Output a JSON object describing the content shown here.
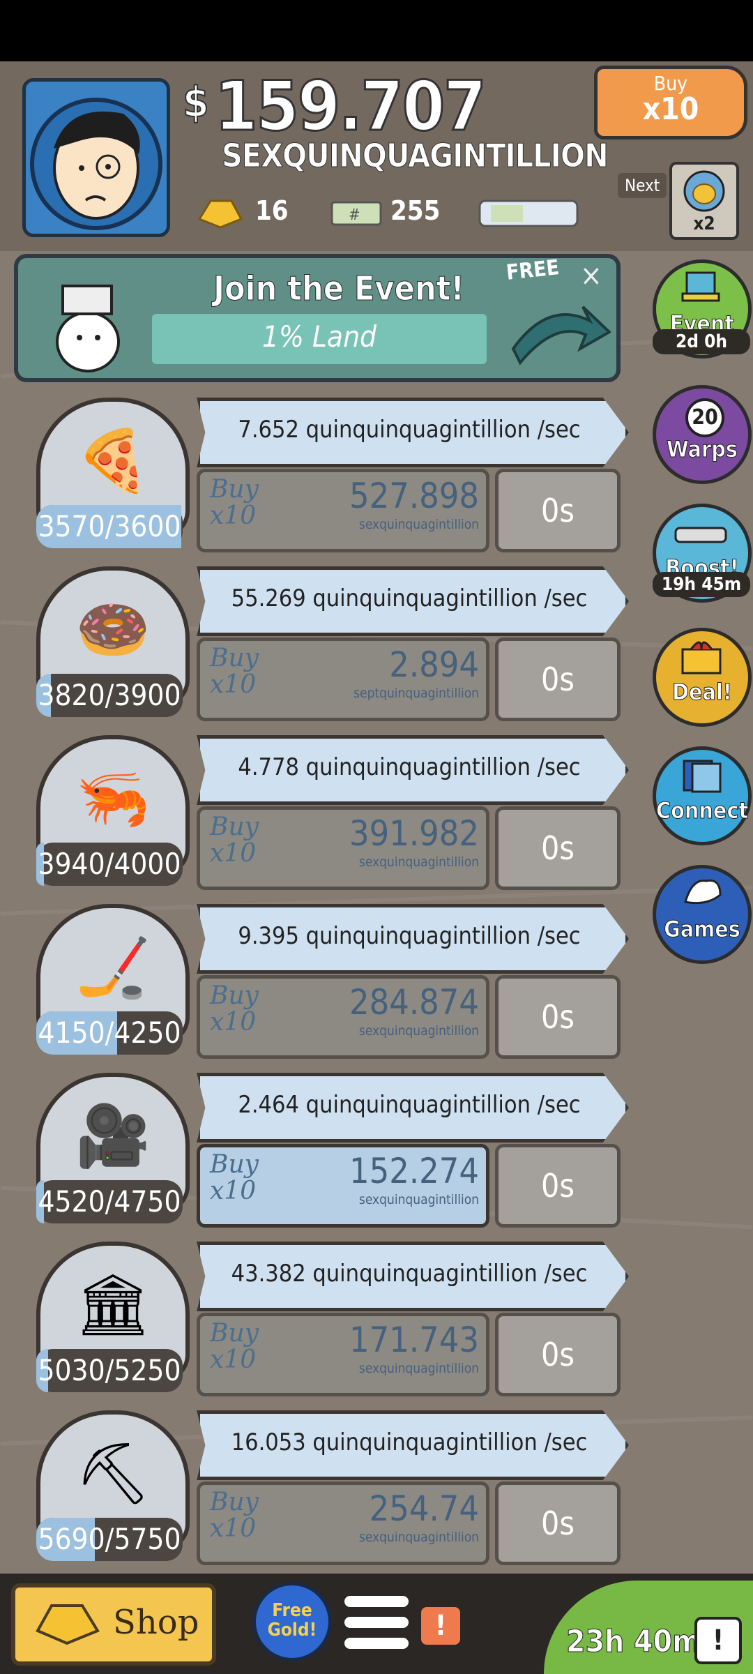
{
  "header": {
    "cash_sign": "$",
    "cash": "159.707",
    "cash_unit": "SEXQUINQUAGINTILLION",
    "gold": "16",
    "megabucks": "255",
    "buy_tag_top": "Buy",
    "buy_tag_bottom": "x10",
    "next_label": "Next",
    "next_multiplier": "x2"
  },
  "event_banner": {
    "title": "Join the Event!",
    "progress_text": "1% Land",
    "free_label": "FREE",
    "close": "×"
  },
  "side_buttons": [
    {
      "label": "Event",
      "sub": "2d 0h",
      "color": "#7cc04a"
    },
    {
      "label": "Warps",
      "badge": "20",
      "color": "#7c4aa0"
    },
    {
      "label": "Boost!",
      "sub": "19h 45m",
      "color": "#5ab7d8"
    },
    {
      "label": "Deal!",
      "color": "#e6b12f"
    },
    {
      "label": "Connect",
      "color": "#3aa6d8"
    },
    {
      "label": "Games",
      "color": "#2d5fb8"
    }
  ],
  "businesses": [
    {
      "icon": "pizza-icon",
      "glyph": "🍕",
      "count": "3570/3600",
      "progress": 0.99,
      "rate": "7.652 quinquinquagintillion /sec",
      "buy_label": "Buy\nx10",
      "price": "527.898",
      "unit": "sexquinquagintillion",
      "timer": "0s",
      "affordable": false
    },
    {
      "icon": "donut-icon",
      "glyph": "🍩",
      "count": "3820/3900",
      "progress": 0.1,
      "rate": "55.269 quinquinquagintillion /sec",
      "buy_label": "Buy\nx10",
      "price": "2.894",
      "unit": "septquinquagintillion",
      "timer": "0s",
      "affordable": false
    },
    {
      "icon": "shrimp-icon",
      "glyph": "🦐",
      "count": "3940/4000",
      "progress": 0.05,
      "rate": "4.778 quinquinquagintillion /sec",
      "buy_label": "Buy\nx10",
      "price": "391.982",
      "unit": "sexquinquagintillion",
      "timer": "0s",
      "affordable": false
    },
    {
      "icon": "hockey-icon",
      "glyph": "🏒",
      "count": "4150/4250",
      "progress": 0.55,
      "rate": "9.395 quinquinquagintillion /sec",
      "buy_label": "Buy\nx10",
      "price": "284.874",
      "unit": "sexquinquagintillion",
      "timer": "0s",
      "affordable": false
    },
    {
      "icon": "movie-camera-icon",
      "glyph": "🎥",
      "count": "4520/4750",
      "progress": 0.05,
      "rate": "2.464 quinquinquagintillion /sec",
      "buy_label": "Buy\nx10",
      "price": "152.274",
      "unit": "sexquinquagintillion",
      "timer": "0s",
      "affordable": true
    },
    {
      "icon": "bank-icon",
      "glyph": "🏛",
      "count": "5030/5250",
      "progress": 0.08,
      "rate": "43.382 quinquinquagintillion /sec",
      "buy_label": "Buy\nx10",
      "price": "171.743",
      "unit": "sexquinquagintillion",
      "timer": "0s",
      "affordable": false
    },
    {
      "icon": "oil-pump-icon",
      "glyph": "⛏",
      "count": "5690/5750",
      "progress": 0.4,
      "rate": "16.053 quinquinquagintillion /sec",
      "buy_label": "Buy\nx10",
      "price": "254.74",
      "unit": "sexquinquagintillion",
      "timer": "0s",
      "affordable": false
    }
  ],
  "bottom": {
    "shop": "Shop",
    "free_gold": "Free\nGold!",
    "alert": "!",
    "tv_timer": "23h 40m",
    "tv_alert": "!"
  }
}
